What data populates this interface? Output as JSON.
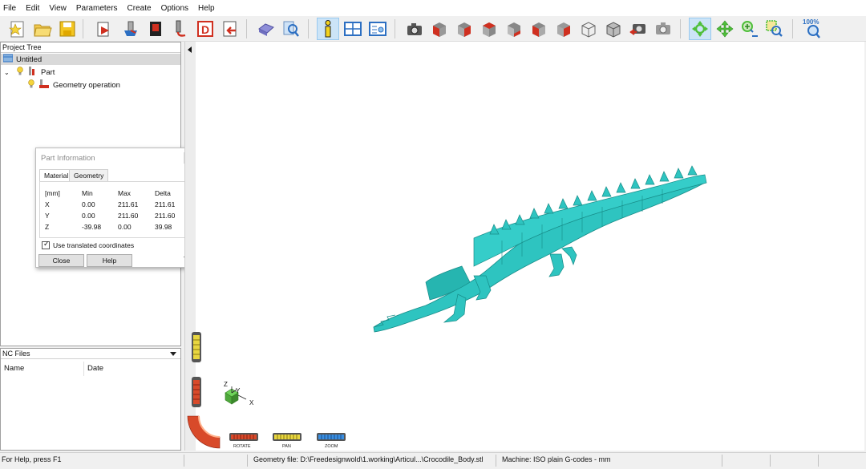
{
  "menu": [
    "File",
    "Edit",
    "View",
    "Parameters",
    "Create",
    "Options",
    "Help"
  ],
  "toolbar": {
    "zoom_label": "100%",
    "buttons": [
      "new-file-icon",
      "open-folder-icon",
      "save-icon",
      "import-part-icon",
      "stock-icon",
      "fixture-icon",
      "tool-icon",
      "design-icon",
      "export-icon",
      "simulate-icon",
      "inspect-icon",
      "info-icon",
      "layout-grid-icon",
      "list-view-icon",
      "snapshot-camera-icon",
      "view-front-icon",
      "view-back-icon",
      "view-left-icon",
      "view-right-icon",
      "view-top-icon",
      "view-bottom-icon",
      "view-iso-icon",
      "view-box-icon",
      "camera-red-icon",
      "camera-gray-icon",
      "rotate-icon",
      "pan-icon",
      "zoom-in-icon",
      "zoom-window-icon",
      "zoom-fit-icon"
    ]
  },
  "project_tree": {
    "title": "Project Tree",
    "root": "Untitled",
    "part": "Part",
    "operation": "Geometry operation"
  },
  "part_info": {
    "title": "Part Information",
    "tabs": [
      "Material",
      "Geometry"
    ],
    "headers": [
      "[mm]",
      "Min",
      "Max",
      "Delta"
    ],
    "rows": [
      {
        "axis": "X",
        "min": "0.00",
        "max": "211.61",
        "delta": "211.61"
      },
      {
        "axis": "Y",
        "min": "0.00",
        "max": "211.60",
        "delta": "211.60"
      },
      {
        "axis": "Z",
        "min": "-39.98",
        "max": "0.00",
        "delta": "39.98"
      }
    ],
    "checkbox_label": "Use translated coordinates",
    "checkbox_checked": true,
    "close_label": "Close",
    "help_label": "Help"
  },
  "nc_files": {
    "title": "NC Files",
    "columns": [
      "Name",
      "Date"
    ]
  },
  "viewport": {
    "model_color": "#2ec4c0",
    "axis_labels": {
      "x": "X",
      "y": "Y",
      "z": "Z"
    },
    "controls": [
      "ROTATE",
      "PAN",
      "ZOOM"
    ]
  },
  "status": {
    "help": "For Help, press F1",
    "geometry": "Geometry file: D:\\Freedesignwold\\1.working\\Articul...\\Crocodile_Body.stl",
    "machine": "Machine: ISO plain G-codes - mm"
  }
}
